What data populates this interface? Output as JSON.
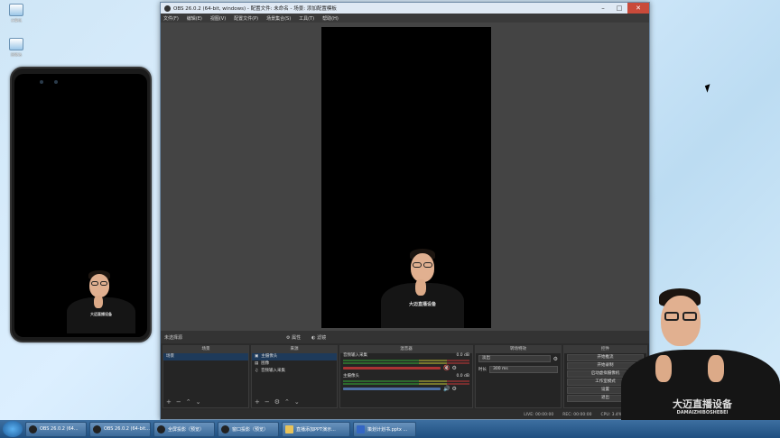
{
  "desktop": {
    "icons": [
      {
        "label": "计算机"
      },
      {
        "label": "回收站"
      }
    ]
  },
  "obs": {
    "title": "OBS 26.0.2 (64-bit, windows) - 配置文件: 未命名 - 场景: 添加配置模板",
    "menu": [
      "文件(F)",
      "编辑(E)",
      "视图(V)",
      "配置文件(P)",
      "场景集合(S)",
      "工具(T)",
      "帮助(H)"
    ],
    "preview_status": {
      "source_label": "未选择源",
      "properties_btn": "属性",
      "filters_btn": "滤镜"
    },
    "docks": {
      "scenes": {
        "header": "场景",
        "items": [
          "场景"
        ]
      },
      "sources": {
        "header": "来源",
        "items": [
          "主摄像头",
          "图像",
          "音频输入采集"
        ]
      },
      "mixer": {
        "header": "混音器",
        "channels": [
          {
            "name": "音频输入采集",
            "db": "0.0 dB"
          },
          {
            "name": "主摄像头",
            "db": "0.0 dB"
          }
        ]
      },
      "transitions": {
        "header": "转场特效",
        "type": "淡出",
        "duration_label": "时长",
        "duration_value": "300 ms"
      },
      "controls": {
        "header": "控件",
        "buttons": [
          "开始推流",
          "开始录制",
          "启动虚拟摄像机",
          "工作室模式",
          "设置",
          "退出"
        ]
      }
    },
    "statusbar": {
      "live": "LIVE: 00:00:00",
      "rec": "REC: 00:00:00",
      "cpu": "CPU: 3.4%, 60.00 fps"
    },
    "shirt_text": "大迈直播设备"
  },
  "taskbar": {
    "tasks": [
      {
        "label": "OBS 26.0.2 (64..."
      },
      {
        "label": "OBS 26.0.2 (64-bit..."
      },
      {
        "label": "全屏投影（预览）"
      },
      {
        "label": "窗口投影（预览）"
      },
      {
        "label": "直播添加PPT演示..."
      },
      {
        "label": "策划计划书.pptx ..."
      }
    ]
  },
  "person_overlay": {
    "shirt_text": "大迈直播设备",
    "shirt_subtext": "DAMAIZHIBOSHEBEI"
  }
}
